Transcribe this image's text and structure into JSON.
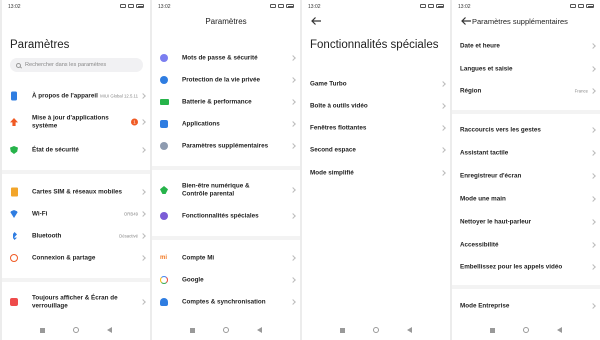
{
  "status": {
    "time": "13:02"
  },
  "screen1": {
    "title": "Paramètres",
    "search_placeholder": "Rechercher dans les paramètres",
    "items": [
      {
        "label": "À propos de l'appareil",
        "value": "MIUI Global 12.5.11",
        "icon": "phone-icon",
        "color": "#2f7de1"
      },
      {
        "label": "Mise à jour d'applications système",
        "badge": "1",
        "icon": "arrow-up-icon",
        "color": "#f05a24"
      },
      {
        "label": "État de sécurité",
        "icon": "shield-icon",
        "color": "#26b34a"
      },
      {
        "label": "Cartes SIM & réseaux mobiles",
        "icon": "sim-icon",
        "color": "#f2a52a"
      },
      {
        "label": "Wi-Fi",
        "value": "ORB49",
        "icon": "wifi-icon",
        "color": "#2f7de1"
      },
      {
        "label": "Bluetooth",
        "value": "Désactivé",
        "icon": "bluetooth-icon",
        "color": "#2f7de1"
      },
      {
        "label": "Connexion & partage",
        "icon": "connection-icon",
        "color": "#f05a24"
      },
      {
        "label": "Toujours afficher & Écran de verrouillage",
        "icon": "lock-screen-icon",
        "color": "#ee4b4b"
      }
    ]
  },
  "screen2": {
    "title": "Paramètres",
    "items": [
      {
        "label": "Mots de passe & sécurité",
        "icon": "password-icon",
        "color": "#7b7ef0"
      },
      {
        "label": "Protection de la vie privée",
        "icon": "privacy-icon",
        "color": "#2f7de1"
      },
      {
        "label": "Batterie & performance",
        "icon": "battery-icon",
        "color": "#26b34a"
      },
      {
        "label": "Applications",
        "icon": "apps-icon",
        "color": "#2f7de1"
      },
      {
        "label": "Paramètres supplémentaires",
        "icon": "more-settings-icon",
        "color": "#8e9bb0"
      },
      {
        "label": "Bien-être numérique & Contrôle parental",
        "icon": "wellbeing-icon",
        "color": "#26b34a"
      },
      {
        "label": "Fonctionnalités spéciales",
        "icon": "special-features-icon",
        "color": "#7b5cd6"
      },
      {
        "label": "Compte Mi",
        "icon": "mi-icon",
        "color": "#f27a24"
      },
      {
        "label": "Google",
        "icon": "google-icon",
        "color": "#4285f4"
      },
      {
        "label": "Comptes & synchronisation",
        "icon": "accounts-icon",
        "color": "#2f7de1"
      }
    ]
  },
  "screen3": {
    "title": "Fonctionnalités spéciales",
    "items": [
      {
        "label": "Game Turbo"
      },
      {
        "label": "Boîte à outils vidéo"
      },
      {
        "label": "Fenêtres flottantes"
      },
      {
        "label": "Second espace"
      },
      {
        "label": "Mode simplifié"
      }
    ]
  },
  "screen4": {
    "title": "Paramètres supplémentaires",
    "items": [
      {
        "label": "Date et heure"
      },
      {
        "label": "Langues et saisie"
      },
      {
        "label": "Région",
        "value": "France"
      },
      {
        "label": "Raccourcis vers les gestes"
      },
      {
        "label": "Assistant tactile"
      },
      {
        "label": "Enregistreur d'écran"
      },
      {
        "label": "Mode une main"
      },
      {
        "label": "Nettoyer le haut-parleur"
      },
      {
        "label": "Accessibilité"
      },
      {
        "label": "Embellissez pour les appels vidéo"
      },
      {
        "label": "Mode Entreprise"
      }
    ]
  }
}
